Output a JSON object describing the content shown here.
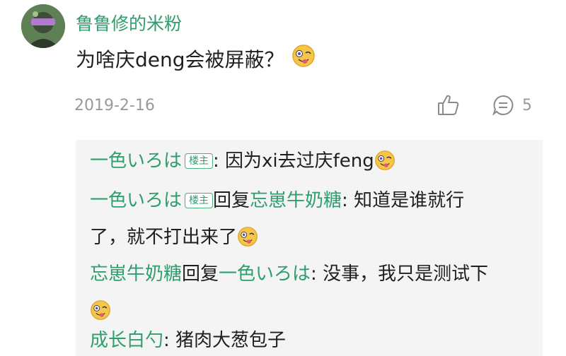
{
  "comment": {
    "username": "鲁鲁修的米粉",
    "text": "为啥庆deng会被屏蔽？",
    "date": "2019-2-16",
    "reply_count": "5"
  },
  "replies": [
    {
      "author": "一色いろは",
      "badge": "楼主",
      "sep": ":",
      "text": " 因为xi去过庆feng"
    },
    {
      "author": "一色いろは",
      "badge": "楼主",
      "reply_word": "回复",
      "target": "忘崽牛奶糖",
      "sep": ":",
      "text": " 知道是谁就行",
      "text2": "了，就不打出来了"
    },
    {
      "author": "忘崽牛奶糖",
      "reply_word": "回复",
      "target": "一色いろは",
      "sep": ":",
      "text": " 没事，我只是测试下"
    },
    {
      "author": "成长白勺",
      "sep": ":",
      "text": " 猪肉大葱包子"
    }
  ],
  "colors": {
    "accent_green": "#2f9e6e",
    "muted": "#9a9a9a",
    "reply_bg": "#f4f4f4"
  },
  "icons": [
    "avatar",
    "wink-tongue-emoji",
    "thumbs-up-icon",
    "reply-bubble-icon"
  ]
}
